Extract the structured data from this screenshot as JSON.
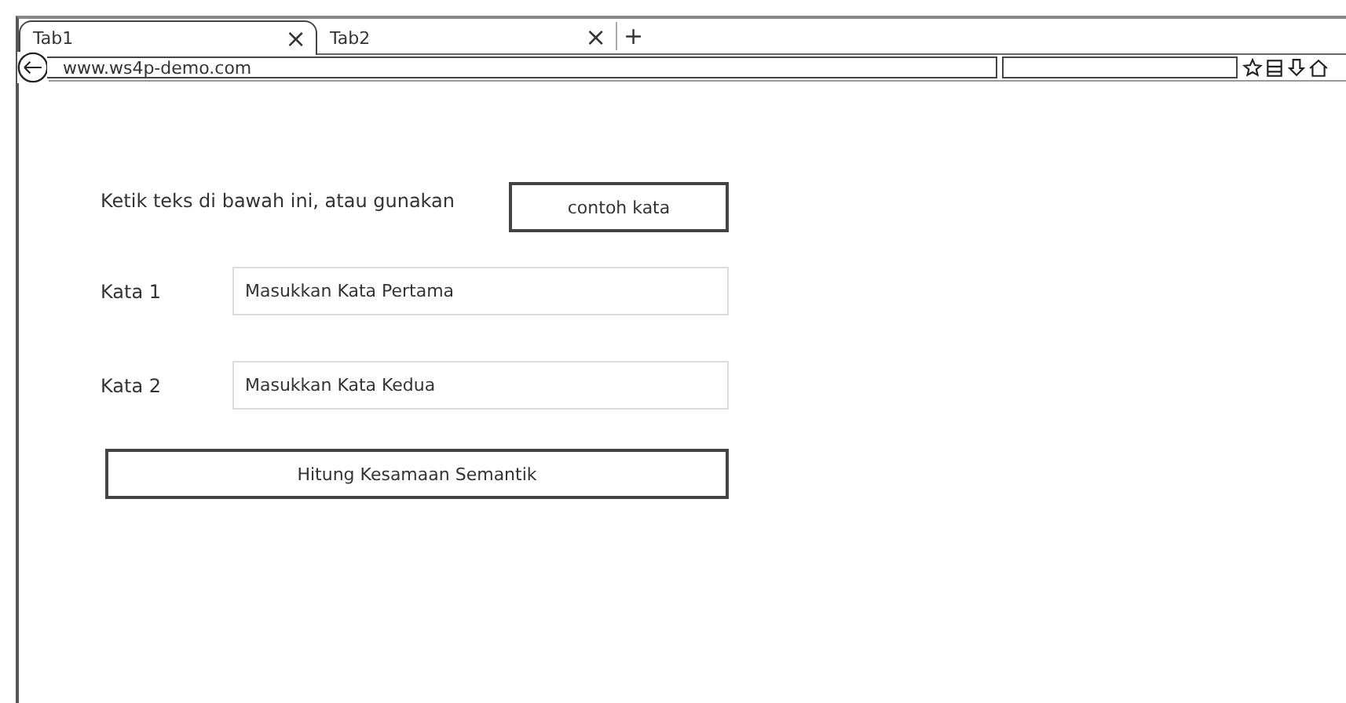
{
  "tabs": [
    {
      "label": "Tab1",
      "selected": true,
      "close": "×"
    },
    {
      "label": "Tab2",
      "selected": false,
      "close": "×"
    }
  ],
  "new_tab": "+",
  "address_bar": {
    "value": "www.ws4p-demo.com"
  },
  "prompt": {
    "text": "Ketik teks di bawah ini, atau gunakan",
    "button": "contoh kata"
  },
  "fields": [
    {
      "label": "Kata 1",
      "placeholder": "Masukkan Kata Pertama"
    },
    {
      "label": "Kata 2",
      "placeholder": "Masukkan Kata Kedua"
    }
  ],
  "submit_button": "Hitung Kesamaan Semantik"
}
